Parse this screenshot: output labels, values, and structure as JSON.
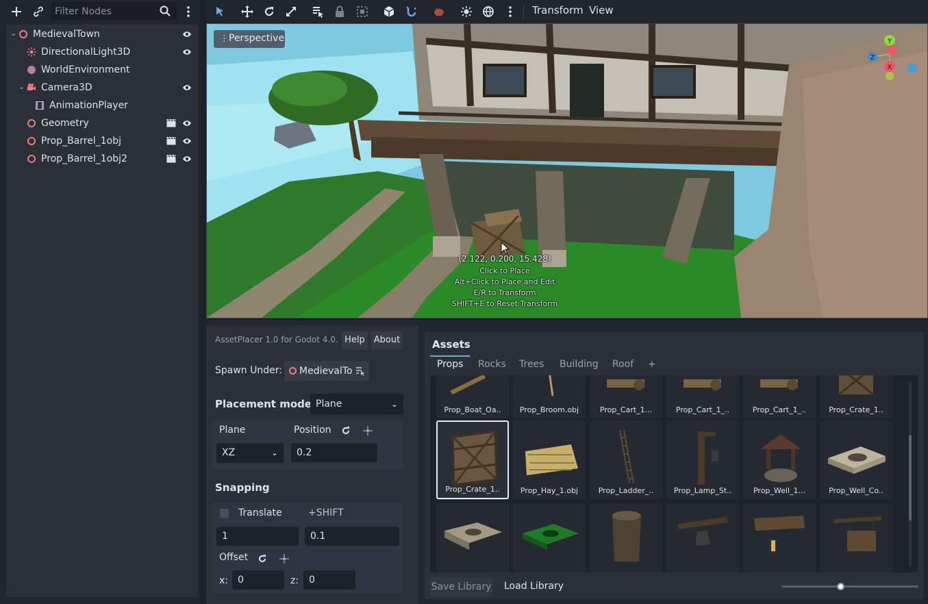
{
  "scene_dock": {
    "toolbar": {
      "add_icon": "plus-icon",
      "link_icon": "link-icon",
      "filter_placeholder": "Filter Nodes",
      "search_icon": "search-icon",
      "more_icon": "kebab-menu-icon"
    },
    "tree": [
      {
        "label": "MedievalTown",
        "icon": "node3d-icon",
        "expanded": true,
        "visible_toggle": true
      },
      {
        "label": "DirectionalLight3D",
        "icon": "sun-light-icon",
        "visible_toggle": true
      },
      {
        "label": "WorldEnvironment",
        "icon": "globe-icon"
      },
      {
        "label": "Camera3D",
        "icon": "camera-icon",
        "expanded": true,
        "visible_toggle": true
      },
      {
        "label": "AnimationPlayer",
        "icon": "film-icon"
      },
      {
        "label": "Geometry",
        "icon": "node3d-icon",
        "scene_instance": true,
        "visible_toggle": true
      },
      {
        "label": "Prop_Barrel_1obj",
        "icon": "node3d-icon",
        "scene_instance": true,
        "visible_toggle": true
      },
      {
        "label": "Prop_Barrel_1obj2",
        "icon": "node3d-icon",
        "scene_instance": true,
        "visible_toggle": true
      }
    ]
  },
  "top_toolbar": {
    "tools": [
      "select-icon",
      "move-icon",
      "rotate-icon",
      "scale-icon",
      "list-select-icon",
      "lock-icon",
      "group-icon",
      "mesh-icon",
      "snap-icon",
      "camera-bone-icon",
      "sun-icon",
      "environment-icon",
      "more-icon"
    ],
    "menus": [
      "Transform",
      "View"
    ]
  },
  "viewport": {
    "perspective_label": "Perspective",
    "coordinates": "(2.122, 0.200, 15.428)",
    "hints": [
      "Click to Place",
      "Alt+Click to Place and Edit",
      "E/R to Transform",
      "SHIFT+E to Reset Transform"
    ],
    "gizmo_axes": [
      "Y",
      "Z",
      "X"
    ]
  },
  "placer": {
    "title": "AssetPlacer 1.0 for Godot 4.0.",
    "help_label": "Help",
    "about_label": "About",
    "spawn_under_label": "Spawn Under:",
    "spawn_under_value": "MedievalTo",
    "placement_mode_label": "Placement mode:",
    "placement_mode_value": "Plane",
    "plane_label": "Plane",
    "position_label": "Position",
    "plane_value": "XZ",
    "position_value": "0.2",
    "snapping_label": "Snapping",
    "translate_label": "Translate",
    "translate_checked": false,
    "shift_label": "+SHIFT",
    "snap_value": "1",
    "snap_shift_value": "0.1",
    "offset_label": "Offset",
    "x_label": "x:",
    "x_value": "0",
    "z_label": "z:",
    "z_value": "0"
  },
  "assets": {
    "title": "Assets",
    "tabs": [
      "Props",
      "Rocks",
      "Trees",
      "Building",
      "Roof",
      "+"
    ],
    "active_tab": "Props",
    "rows": [
      [
        "Prop_Boat_Oa..",
        "Prop_Broom.obj",
        "Prop_Cart_1...",
        "Prop_Cart_1_..",
        "Prop_Cart_1_..",
        "Prop_Crate_1.."
      ],
      [
        "Prop_Crate_1..",
        "Prop_Hay_1.obj",
        "Prop_Ladder_..",
        "Prop_Lamp_St..",
        "Prop_Well_1...",
        "Prop_Well_Co.."
      ],
      [
        "",
        "",
        "",
        "",
        "",
        ""
      ]
    ],
    "selected": "Prop_Crate_1..",
    "save_label": "Save Library",
    "load_label": "Load Library",
    "zoom_fraction": 0.43
  }
}
